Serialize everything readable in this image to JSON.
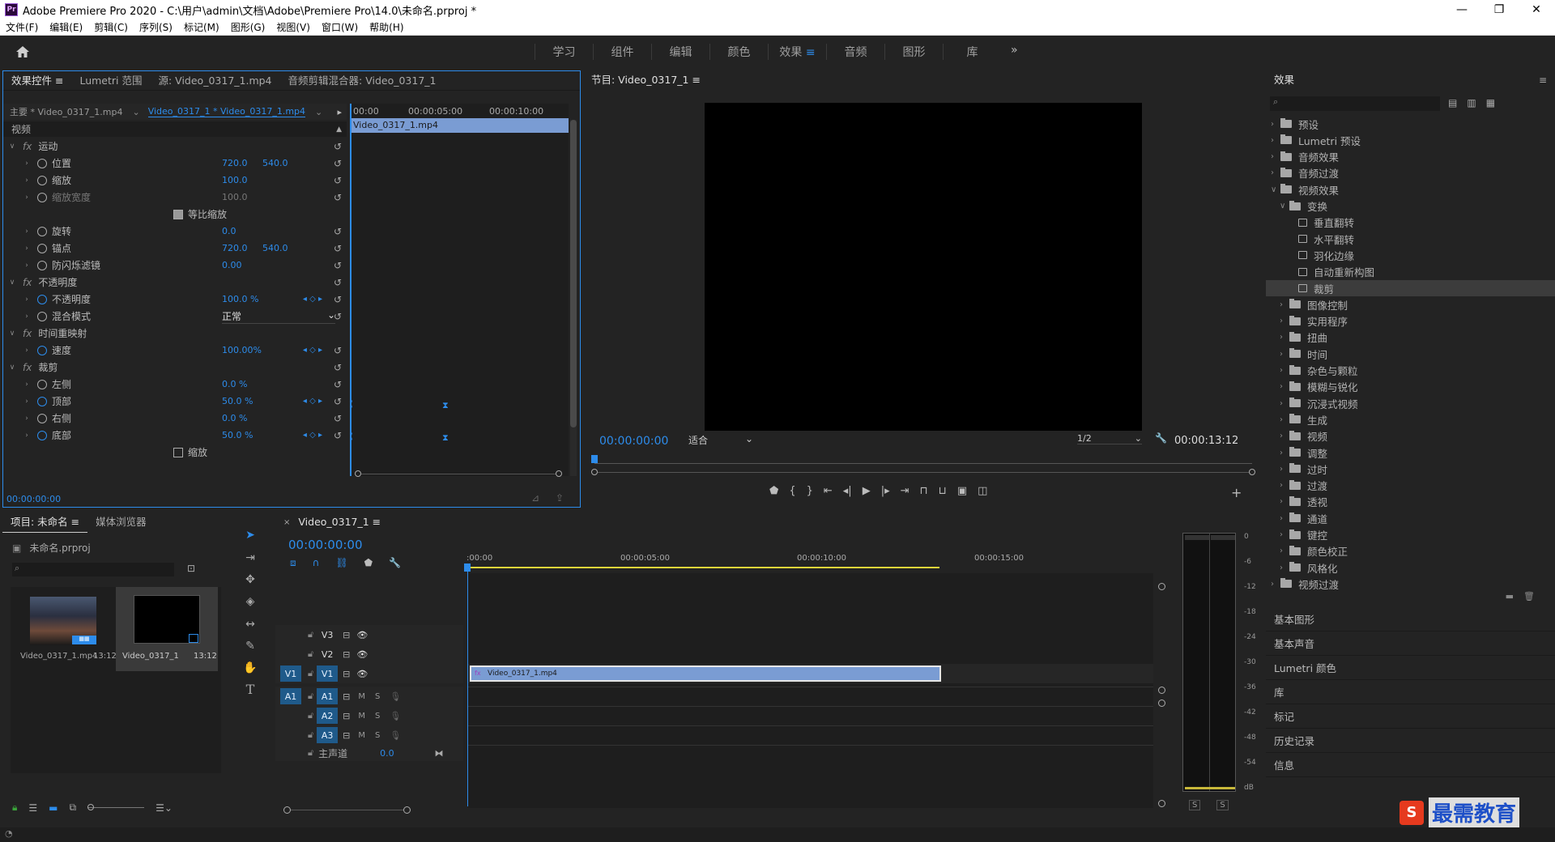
{
  "titlebar": {
    "title": "Adobe Premiere Pro 2020 - C:\\用户\\admin\\文档\\Adobe\\Premiere Pro\\14.0\\未命名.prproj *",
    "logo": "Pr"
  },
  "menu": [
    "文件(F)",
    "编辑(E)",
    "剪辑(C)",
    "序列(S)",
    "标记(M)",
    "图形(G)",
    "视图(V)",
    "窗口(W)",
    "帮助(H)"
  ],
  "workspaces": [
    "学习",
    "组件",
    "编辑",
    "颜色",
    "效果",
    "音频",
    "图形",
    "库"
  ],
  "active_workspace": "效果",
  "effect_controls": {
    "tabs": [
      "效果控件",
      "Lumetri 范围",
      "源: Video_0317_1.mp4",
      "音频剪辑混合器: Video_0317_1"
    ],
    "master": "主要 * Video_0317_1.mp4",
    "clip": "Video_0317_1 * Video_0317_1.mp4",
    "ruler": [
      "00:00",
      "00:00:05:00",
      "00:00:10:00"
    ],
    "clip_bar": "Video_0317_1.mp4",
    "section_video": "视频",
    "rows": [
      {
        "label": "运动",
        "fx": true
      },
      {
        "label": "位置",
        "v1": "720.0",
        "v2": "540.0"
      },
      {
        "label": "缩放",
        "v1": "100.0"
      },
      {
        "label": "缩放宽度",
        "v1": "100.0",
        "dim": true
      },
      {
        "label": "等比缩放",
        "checkbox": true
      },
      {
        "label": "旋转",
        "v1": "0.0"
      },
      {
        "label": "锚点",
        "v1": "720.0",
        "v2": "540.0"
      },
      {
        "label": "防闪烁滤镜",
        "v1": "0.00"
      },
      {
        "label": "不透明度",
        "fx": true
      },
      {
        "label": "不透明度",
        "v1": "100.0 %"
      },
      {
        "label": "混合模式",
        "select": "正常"
      },
      {
        "label": "时间重映射",
        "fx": true
      },
      {
        "label": "速度",
        "v1": "100.00%"
      },
      {
        "label": "裁剪",
        "fx": true
      },
      {
        "label": "左侧",
        "v1": "0.0 %"
      },
      {
        "label": "顶部",
        "v1": "50.0 %"
      },
      {
        "label": "右侧",
        "v1": "0.0 %"
      },
      {
        "label": "底部",
        "v1": "50.0 %"
      },
      {
        "label": "缩放",
        "checkbox": true
      }
    ],
    "timecode": "00:00:00:00"
  },
  "program": {
    "title": "节目: Video_0317_1",
    "timecode": "00:00:00:00",
    "fit": "适合",
    "resolution": "1/2",
    "duration": "00:00:13:12"
  },
  "effects": {
    "title": "效果",
    "tree": [
      {
        "label": "预设",
        "level": 0,
        "open": false
      },
      {
        "label": "Lumetri 预设",
        "level": 0,
        "open": false
      },
      {
        "label": "音频效果",
        "level": 0,
        "open": false
      },
      {
        "label": "音频过渡",
        "level": 0,
        "open": false
      },
      {
        "label": "视频效果",
        "level": 0,
        "open": true
      },
      {
        "label": "变换",
        "level": 1,
        "open": true
      },
      {
        "label": "垂直翻转",
        "level": 2,
        "leaf": true
      },
      {
        "label": "水平翻转",
        "level": 2,
        "leaf": true
      },
      {
        "label": "羽化边缘",
        "level": 2,
        "leaf": true
      },
      {
        "label": "自动重新构图",
        "level": 2,
        "leaf": true
      },
      {
        "label": "裁剪",
        "level": 2,
        "leaf": true,
        "selected": true
      },
      {
        "label": "图像控制",
        "level": 1
      },
      {
        "label": "实用程序",
        "level": 1
      },
      {
        "label": "扭曲",
        "level": 1
      },
      {
        "label": "时间",
        "level": 1
      },
      {
        "label": "杂色与颗粒",
        "level": 1
      },
      {
        "label": "模糊与锐化",
        "level": 1
      },
      {
        "label": "沉浸式视频",
        "level": 1
      },
      {
        "label": "生成",
        "level": 1
      },
      {
        "label": "视频",
        "level": 1
      },
      {
        "label": "调整",
        "level": 1
      },
      {
        "label": "过时",
        "level": 1
      },
      {
        "label": "过渡",
        "level": 1
      },
      {
        "label": "透视",
        "level": 1
      },
      {
        "label": "通道",
        "level": 1
      },
      {
        "label": "键控",
        "level": 1
      },
      {
        "label": "颜色校正",
        "level": 1
      },
      {
        "label": "风格化",
        "level": 1
      },
      {
        "label": "视频过渡",
        "level": 0
      }
    ],
    "side_panels": [
      "基本图形",
      "基本声音",
      "Lumetri 颜色",
      "库",
      "标记",
      "历史记录",
      "信息"
    ]
  },
  "project": {
    "tabs": [
      "项目: 未命名",
      "媒体浏览器"
    ],
    "file": "未命名.prproj",
    "items": [
      {
        "name": "Video_0317_1.mp4",
        "duration": "13:12"
      },
      {
        "name": "Video_0317_1",
        "duration": "13:12"
      }
    ]
  },
  "timeline": {
    "title": "Video_0317_1",
    "timecode": "00:00:00:00",
    "ruler": [
      ":00:00",
      "00:00:05:00",
      "00:00:10:00",
      "00:00:15:00"
    ],
    "video_tracks": [
      "V3",
      "V2",
      "V1"
    ],
    "audio_tracks": [
      "A1",
      "A2",
      "A3"
    ],
    "master": "主声道",
    "master_value": "0.0",
    "clip_label": "Video_0317_1.mp4",
    "src_v": "V1",
    "src_a": "A1"
  },
  "meter": {
    "labels": [
      "0",
      "-6",
      "-12",
      "-18",
      "-24",
      "-30",
      "-36",
      "-42",
      "-48",
      "-54",
      "dB"
    ],
    "solo": [
      "S",
      "S"
    ]
  },
  "watermark": "最需教育"
}
